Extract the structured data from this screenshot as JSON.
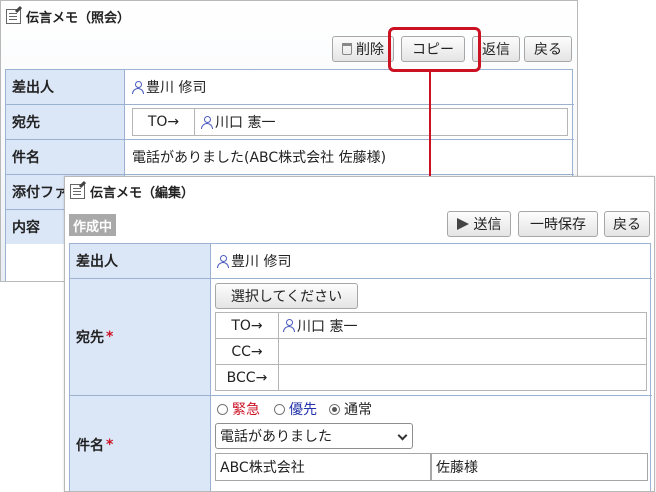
{
  "back_window": {
    "title": "伝言メモ（照会）",
    "buttons": {
      "delete": "削除",
      "copy": "コピー",
      "reply": "返信",
      "back": "戻る"
    },
    "rows": [
      {
        "label": "差出人",
        "value": "豊川 修司"
      },
      {
        "label": "宛先",
        "to_label": "TO→",
        "value": "川口 憲一"
      },
      {
        "label": "件名",
        "value": "電話がありました(ABC株式会社 佐藤様)"
      },
      {
        "label": "添付ファ"
      },
      {
        "label": "内容"
      }
    ]
  },
  "front_window": {
    "title": "伝言メモ（編集）",
    "status_badge": "作成中",
    "buttons": {
      "send": "送信",
      "temp_save": "一時保存",
      "back": "戻る"
    },
    "sender": {
      "label": "差出人",
      "value": "豊川 修司"
    },
    "recipients": {
      "label": "宛先",
      "required_mark": "*",
      "select_button": "選択してください",
      "rows": [
        {
          "type": "TO→",
          "value": "川口 憲一"
        },
        {
          "type": "CC→",
          "value": ""
        },
        {
          "type": "BCC→",
          "value": ""
        }
      ]
    },
    "subject": {
      "label": "件名",
      "required_mark": "*",
      "priority_options": [
        {
          "label": "緊急",
          "color": "#cc1122",
          "selected": false
        },
        {
          "label": "優先",
          "color": "#2233aa",
          "selected": false
        },
        {
          "label": "通常",
          "color": "#222222",
          "selected": true
        }
      ],
      "dropdown_value": "電話がありました",
      "company": "ABC株式会社",
      "person": "佐藤様"
    }
  },
  "colors": {
    "header_bg": "#dbe6f7",
    "border": "#9bb3d0",
    "highlight": "#cc1122"
  }
}
